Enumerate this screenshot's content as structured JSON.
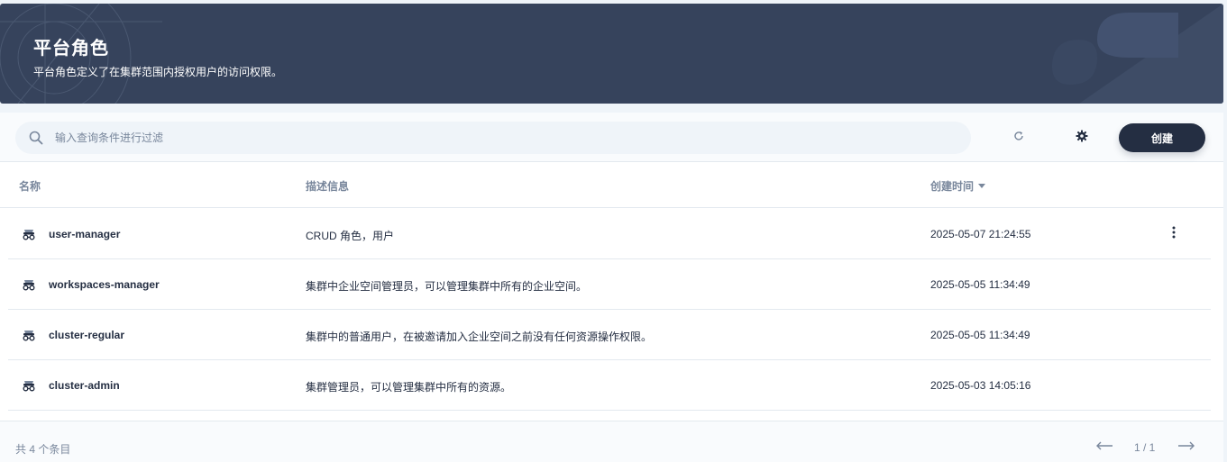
{
  "banner": {
    "title": "平台角色",
    "description": "平台角色定义了在集群范围内授权用户的访问权限。"
  },
  "toolbar": {
    "search_placeholder": "输入查询条件进行过滤",
    "refresh_icon": "refresh-icon",
    "settings_icon": "gear-icon",
    "create_label": "创建"
  },
  "table": {
    "columns": {
      "name": "名称",
      "description": "描述信息",
      "created": "创建时间"
    },
    "rows": [
      {
        "name": "user-manager",
        "description": "CRUD 角色，用户",
        "created": "2025-05-07 21:24:55"
      },
      {
        "name": "workspaces-manager",
        "description": "集群中企业空间管理员，可以管理集群中所有的企业空间。",
        "created": "2025-05-05 11:34:49"
      },
      {
        "name": "cluster-regular",
        "description": "集群中的普通用户，在被邀请加入企业空间之前没有任何资源操作权限。",
        "created": "2025-05-05 11:34:49"
      },
      {
        "name": "cluster-admin",
        "description": "集群管理员，可以管理集群中所有的资源。",
        "created": "2025-05-03 14:05:16"
      }
    ]
  },
  "footer": {
    "total": "共 4 个条目",
    "page": "1 / 1"
  },
  "colors": {
    "banner_bg": "#36435c",
    "primary_dark": "#242e42",
    "muted_text": "#79879c"
  }
}
